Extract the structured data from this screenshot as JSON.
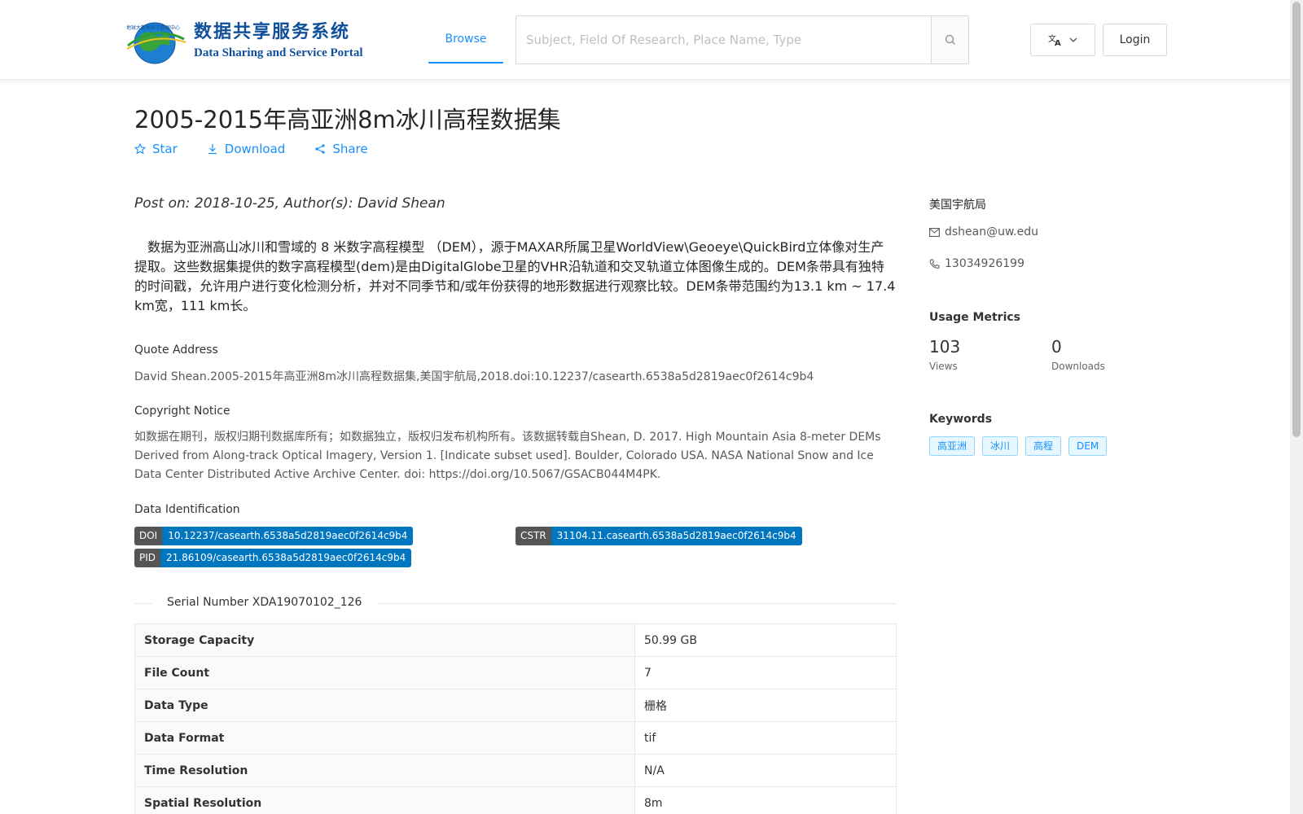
{
  "header": {
    "logo_cn": "数据共享服务系统",
    "logo_en": "Data Sharing and Service Portal",
    "nav_browse": "Browse",
    "search_placeholder": "Subject, Field Of Research, Place Name, Type",
    "login_label": "Login",
    "icons": {
      "search": "search-icon",
      "language": "translate-icon",
      "dropdown": "chevron-down-icon"
    }
  },
  "dataset": {
    "title": "2005-2015年高亚洲8m冰川高程数据集",
    "actions": {
      "star": "Star",
      "download": "Download",
      "share": "Share"
    },
    "post_on": "Post on: 2018-10-25, Author(s): David Shean",
    "description": "数据为亚洲高山冰川和雪域的 8 米数字高程模型 （DEM），源于MAXAR所属卫星WorldView\\Geoeye\\QuickBird立体像对生产提取。这些数据集提供的数字高程模型(dem)是由DigitalGlobe卫星的VHR沿轨道和交叉轨道立体图像生成的。DEM条带具有独特的时间戳，允许用户进行变化检测分析，并对不同季节和/或年份获得的地形数据进行观察比较。DEM条带范围约为13.1 km ~ 17.4 km宽，111 km长。",
    "quote_label": "Quote Address",
    "quote_text": "David Shean.2005-2015年高亚洲8m冰川高程数据集,美国宇航局,2018.doi:10.12237/casearth.6538a5d2819aec0f2614c9b4",
    "copyright_label": "Copyright Notice",
    "copyright_text": "如数据在期刊，版权归期刊数据库所有；如数据独立，版权归发布机构所有。该数据转载自Shean, D. 2017. High Mountain Asia 8-meter DEMs Derived from Along-track Optical Imagery, Version 1. [Indicate subset used]. Boulder, Colorado USA. NASA National Snow and Ice Data Center Distributed Active Archive Center. doi: https://doi.org/10.5067/GSACB044M4PK.",
    "identification_label": "Data Identification",
    "doi_key": "DOI",
    "doi_value": "10.12237/casearth.6538a5d2819aec0f2614c9b4",
    "cstr_key": "CSTR",
    "cstr_value": "31104.11.casearth.6538a5d2819aec0f2614c9b4",
    "pid_key": "PID",
    "pid_value": "21.86109/casearth.6538a5d2819aec0f2614c9b4",
    "serial_number": "Serial Number XDA19070102_126",
    "table": [
      {
        "key": "Storage Capacity",
        "value": "50.99 GB"
      },
      {
        "key": "File Count",
        "value": "7"
      },
      {
        "key": "Data Type",
        "value": "栅格"
      },
      {
        "key": "Data Format",
        "value": "tif"
      },
      {
        "key": "Time Resolution",
        "value": "N/A"
      },
      {
        "key": "Spatial Resolution",
        "value": "8m"
      }
    ]
  },
  "sidebar": {
    "organization": "美国宇航局",
    "email": "dshean@uw.edu",
    "phone": "13034926199",
    "usage_heading": "Usage Metrics",
    "views_count": "103",
    "views_label": "Views",
    "downloads_count": "0",
    "downloads_label": "Downloads",
    "keywords_heading": "Keywords",
    "keywords": [
      "高亚洲",
      "冰川",
      "高程",
      "DEM"
    ]
  },
  "colors": {
    "accent": "#1890ff",
    "badge_key": "#555555",
    "badge_value": "#0076c0"
  }
}
